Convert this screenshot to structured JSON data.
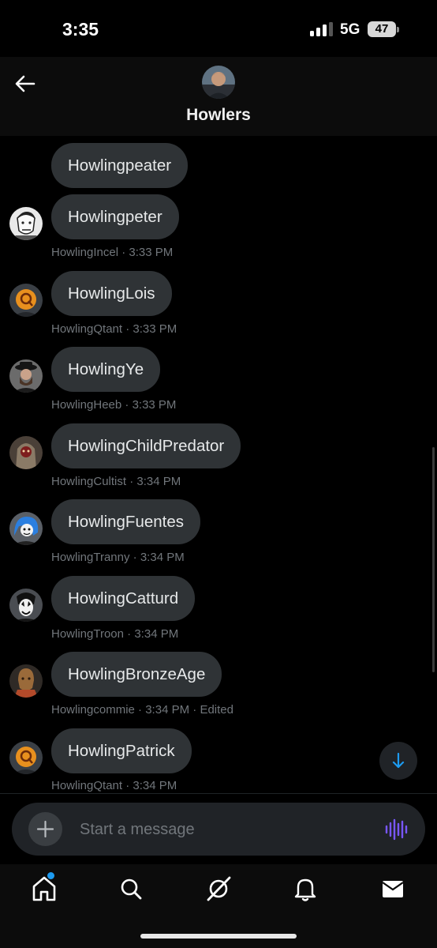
{
  "status_bar": {
    "time": "3:35",
    "network": "5G",
    "battery": "47"
  },
  "header": {
    "title": "Howlers",
    "back_icon": "arrow-left-icon"
  },
  "messages": [
    {
      "text": "Howlingpeater",
      "sender": "",
      "time": "",
      "edited": "",
      "avatar": ""
    },
    {
      "text": "Howlingpeter",
      "sender": "HowlingIncel",
      "time": "3:33 PM",
      "edited": "",
      "avatar": "cartoon-face-avatar"
    },
    {
      "text": "HowlingLois",
      "sender": "HowlingQtant",
      "time": "3:33 PM",
      "edited": "",
      "avatar": "orange-q-avatar"
    },
    {
      "text": "HowlingYe",
      "sender": "HowlingHeeb",
      "time": "3:33 PM",
      "edited": "",
      "avatar": "hat-man-avatar"
    },
    {
      "text": "HowlingChildPredator",
      "sender": "HowlingCultist",
      "time": "3:34 PM",
      "edited": "",
      "avatar": "robed-figure-avatar"
    },
    {
      "text": "HowlingFuentes",
      "sender": "HowlingTranny",
      "time": "3:34 PM",
      "edited": "",
      "avatar": "blue-hair-avatar"
    },
    {
      "text": "HowlingCatturd",
      "sender": "HowlingTroon",
      "time": "3:34 PM",
      "edited": "",
      "avatar": "face-paint-avatar"
    },
    {
      "text": "HowlingBronzeAge",
      "sender": "Howlingcommie",
      "time": "3:34 PM",
      "edited": "Edited",
      "avatar": "bronze-statue-avatar"
    },
    {
      "text": "HowlingPatrick",
      "sender": "HowlingQtant",
      "time": "3:34 PM",
      "edited": "",
      "avatar": "orange-q-avatar"
    }
  ],
  "meta_separator": " · ",
  "composer": {
    "placeholder": "Start a message",
    "add_icon": "plus-icon",
    "voice_icon": "waveform-icon"
  },
  "tab_bar": {
    "tabs": [
      "home-icon",
      "search-icon",
      "grok-icon",
      "bell-icon",
      "mail-icon"
    ],
    "home_has_notification": true
  },
  "colors": {
    "background": "#000000",
    "bubble": "#2f3336",
    "meta_text": "#71767b",
    "accent_blue": "#1d9bf0",
    "voice_purple": "#7856ff"
  }
}
